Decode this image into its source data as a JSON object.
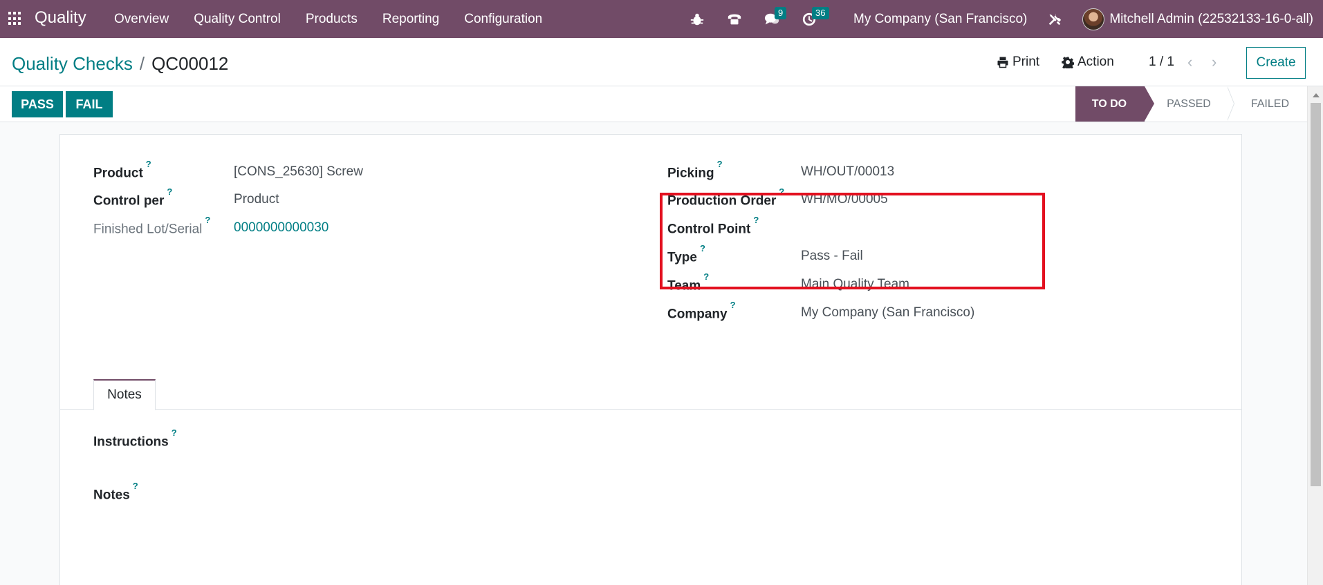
{
  "navbar": {
    "brand": "Quality",
    "menu": [
      "Overview",
      "Quality Control",
      "Products",
      "Reporting",
      "Configuration"
    ],
    "messages_count": "9",
    "activities_count": "36",
    "company": "My Company (San Francisco)",
    "user": "Mitchell Admin (22532133-16-0-all)"
  },
  "control_panel": {
    "breadcrumb_parent": "Quality Checks",
    "breadcrumb_separator": "/",
    "breadcrumb_current": "QC00012",
    "print_label": "Print",
    "action_label": "Action",
    "pager": "1 / 1",
    "create_label": "Create"
  },
  "statusbar": {
    "pass_label": "PASS",
    "fail_label": "FAIL",
    "stages": [
      "TO DO",
      "PASSED",
      "FAILED"
    ],
    "active_stage": "TO DO"
  },
  "form": {
    "help_mark": "?",
    "left": {
      "product_label": "Product",
      "product_value": "[CONS_25630] Screw",
      "control_per_label": "Control per",
      "control_per_value": "Product",
      "lot_label": "Finished Lot/Serial",
      "lot_value": "0000000000030"
    },
    "right": {
      "picking_label": "Picking",
      "picking_value": "WH/OUT/00013",
      "production_order_label": "Production Order",
      "production_order_value": "WH/MO/00005",
      "control_point_label": "Control Point",
      "control_point_value": "",
      "type_label": "Type",
      "type_value": "Pass - Fail",
      "team_label": "Team",
      "team_value": "Main Quality Team",
      "company_label": "Company",
      "company_value": "My Company (San Francisco)"
    },
    "tabs": [
      "Notes"
    ],
    "instructions_label": "Instructions",
    "notes_label": "Notes"
  },
  "colors": {
    "navbar": "#714b67",
    "primary": "#017e84",
    "highlight": "#e3101f"
  }
}
